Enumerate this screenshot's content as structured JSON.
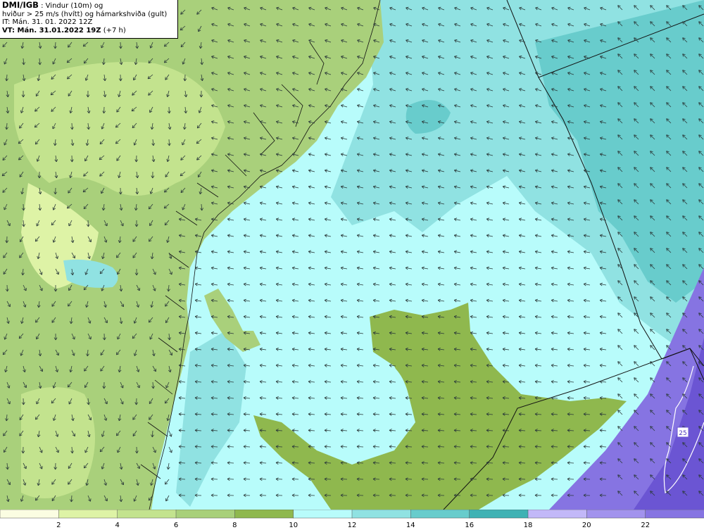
{
  "info": {
    "brand": "DMI/IGB",
    "line1_rest": " : Vindur (10m) og",
    "line2": "hviður > 25 m/s (hvítt) og hámarkshviða (gult)",
    "line3": "IT: Mán. 31. 01. 2022 12Z",
    "vt_label": "VT: Mán. 31.01.2022 19Z",
    "vt_offset": " (+7 h)"
  },
  "map_label": "25",
  "legend": {
    "ticks": [
      "2",
      "4",
      "6",
      "8",
      "10",
      "12",
      "14",
      "16",
      "18",
      "20",
      "22"
    ],
    "colors": [
      "#fbfde2",
      "#def3a6",
      "#c3e38e",
      "#a8d07a",
      "#8fb84e",
      "#b8fcfb",
      "#90e2e2",
      "#68cccc",
      "#3fb2b4",
      "#2b9596",
      "#c2b8f8",
      "#a293ed",
      "#8674e2",
      "#6b55d3",
      "#4c36bd"
    ]
  },
  "colors": {
    "land": "#a9d07b",
    "land_dark": "#8fb84e",
    "sea": "#b8fcfb",
    "sea_mid": "#90e2e2",
    "sea_dark": "#68cccc",
    "storm": "#8674e2",
    "storm_dark": "#6b55d3",
    "arrow": "#2b3a3a",
    "coast": "#111111"
  }
}
